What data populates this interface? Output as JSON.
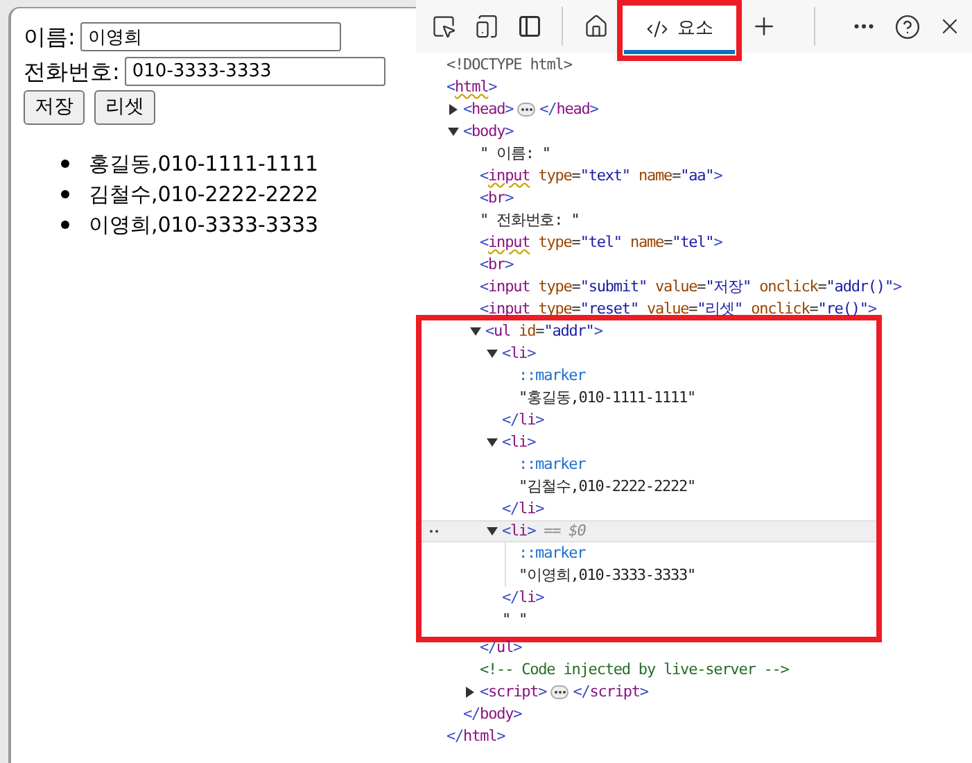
{
  "page": {
    "fields": [
      {
        "label": "이름:",
        "value": "이영희"
      },
      {
        "label": "전화번호:",
        "value": "010-3333-3333"
      }
    ],
    "buttons": [
      "저장",
      "리셋"
    ],
    "list": [
      "홍길동,010-1111-1111",
      "김철수,010-2222-2222",
      "이영희,010-3333-3333"
    ]
  },
  "devtools": {
    "tabs": [
      {
        "label": "요소",
        "selected": true,
        "highlighted": true
      }
    ],
    "dom": [
      {
        "kind": "doctype",
        "text": "<!DOCTYPE html>"
      },
      {
        "kind": "element",
        "text": "<html>",
        "warning": true,
        "close": "</html>",
        "children": [
          {
            "kind": "element",
            "text": "<head>",
            "expanded": false,
            "close": "</head>"
          },
          {
            "kind": "element",
            "text": "<body>",
            "expanded": true,
            "close": "</body>",
            "children": [
              {
                "kind": "text",
                "text": "\" 이름: \""
              },
              {
                "kind": "element",
                "text": "<input type=\"text\" name=\"aa\">",
                "warning": true
              },
              {
                "kind": "element",
                "text": "<br>"
              },
              {
                "kind": "text",
                "text": "\" 전화번호: \""
              },
              {
                "kind": "element",
                "text": "<input type=\"tel\" name=\"tel\">",
                "warning": true
              },
              {
                "kind": "element",
                "text": "<br>"
              },
              {
                "kind": "element",
                "text": "<input type=\"submit\" value=\"저장\" onclick=\"addr()\">"
              },
              {
                "kind": "element",
                "text": "<input type=\"reset\" value=\"리셋\" onclick=\"re()\">"
              },
              {
                "kind": "element",
                "text": "<ul id=\"addr\">",
                "expanded": true,
                "highlighted": true,
                "close": "</ul>",
                "children": [
                  {
                    "kind": "element",
                    "text": "<li>",
                    "expanded": true,
                    "selected": false,
                    "close": "</li>",
                    "children": [
                      {
                        "kind": "marker",
                        "text": "::marker"
                      },
                      {
                        "kind": "text",
                        "text": "\"홍길동,010-1111-1111\""
                      }
                    ]
                  },
                  {
                    "kind": "element",
                    "text": "<li>",
                    "expanded": true,
                    "selected": false,
                    "close": "</li>",
                    "children": [
                      {
                        "kind": "marker",
                        "text": "::marker"
                      },
                      {
                        "kind": "text",
                        "text": "\"김철수,010-2222-2222\""
                      }
                    ]
                  },
                  {
                    "kind": "element",
                    "text": "<li>",
                    "expanded": true,
                    "selected": true,
                    "suffix": "== $0",
                    "close": "</li>",
                    "children": [
                      {
                        "kind": "marker",
                        "text": "::marker"
                      },
                      {
                        "kind": "text",
                        "text": "\"이영희,010-3333-3333\""
                      }
                    ]
                  },
                  {
                    "kind": "text",
                    "text": "\" \""
                  }
                ]
              },
              {
                "kind": "comment",
                "text": "<!-- Code injected by live-server -->"
              },
              {
                "kind": "element",
                "text": "<script>",
                "expanded": false,
                "close": "</script>"
              }
            ]
          }
        ]
      }
    ]
  }
}
